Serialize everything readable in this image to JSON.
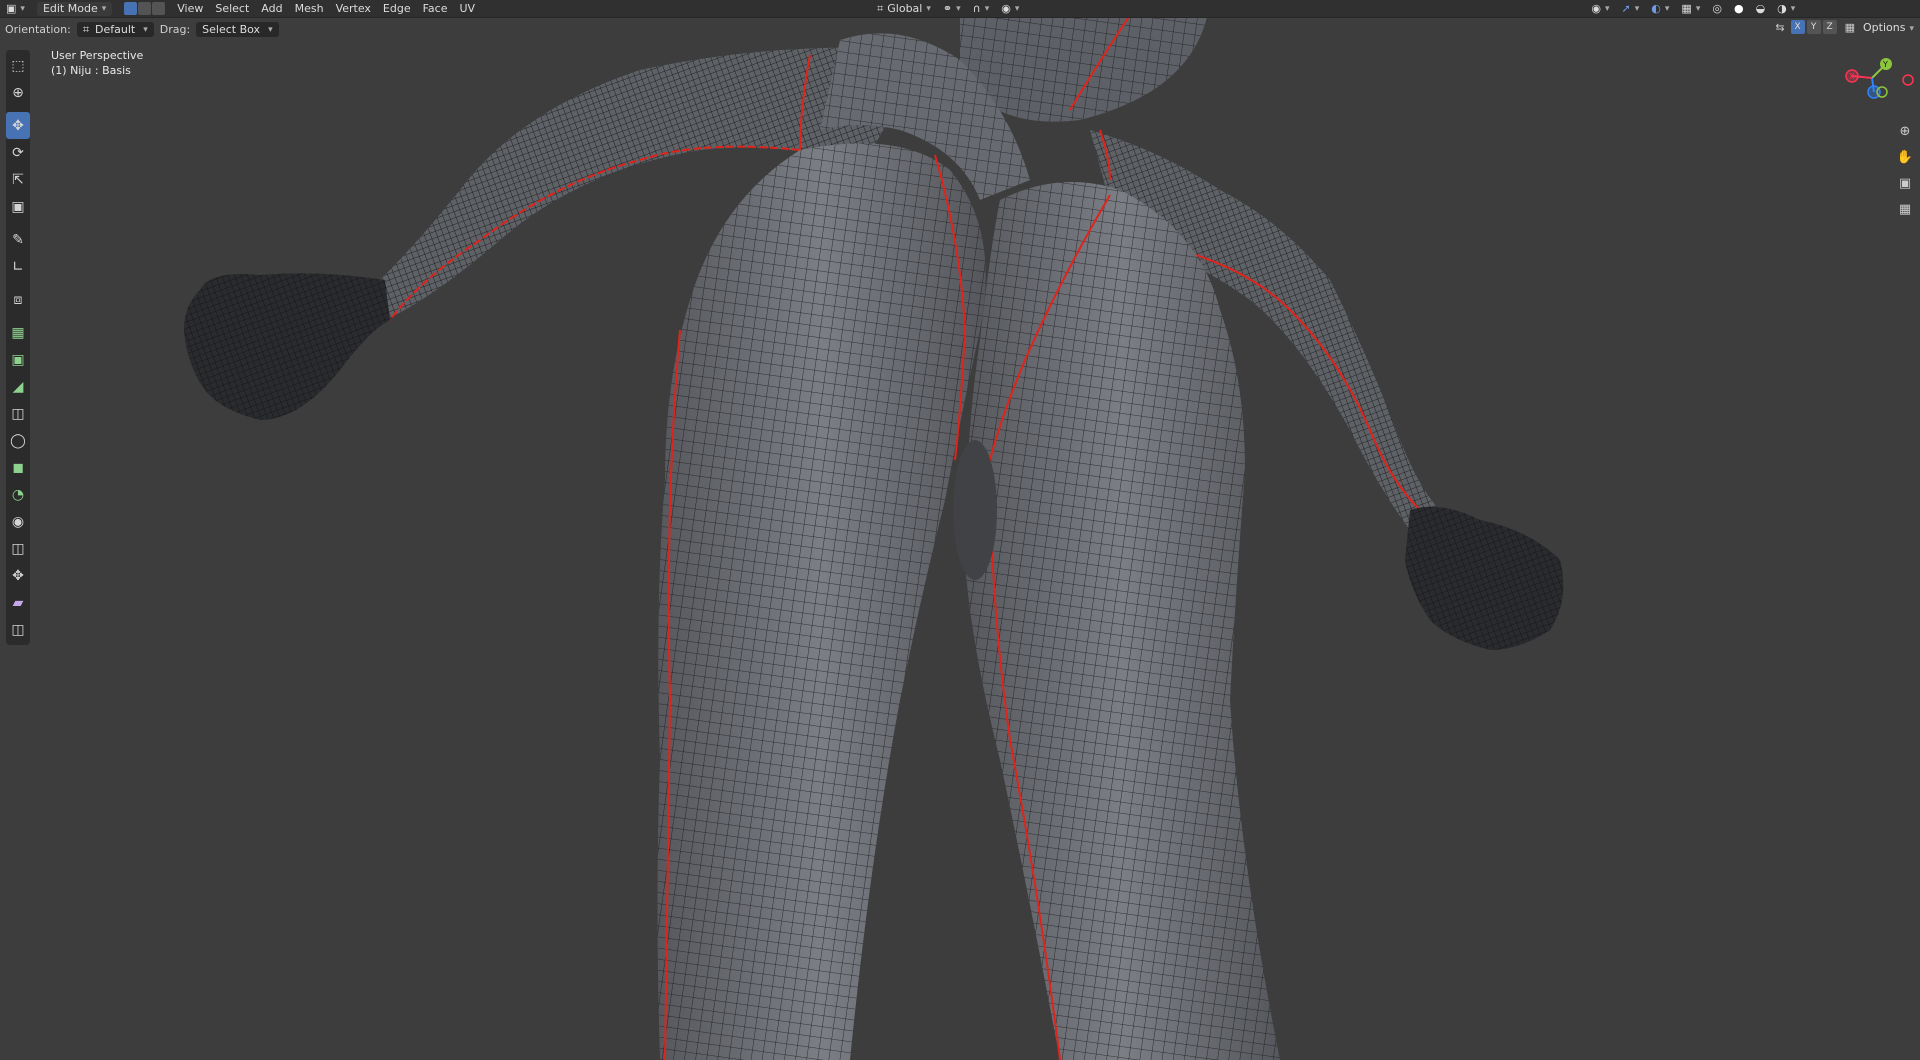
{
  "header": {
    "mode": "Edit Mode",
    "menus": [
      "View",
      "Select",
      "Add",
      "Mesh",
      "Vertex",
      "Edge",
      "Face",
      "UV"
    ],
    "transform_orientation": "Global"
  },
  "tool_header": {
    "orientation_label": "Orientation:",
    "orientation_value": "Default",
    "drag_label": "Drag:",
    "drag_value": "Select Box",
    "options_label": "Options",
    "axes": [
      "X",
      "Y",
      "Z"
    ]
  },
  "viewport": {
    "view_name": "User Perspective",
    "object_info": "(1) Niju : Basis"
  },
  "gizmo_axes": {
    "y": "Y",
    "x": "X"
  },
  "toolbar_icons": [
    "select-box-icon",
    "cursor-icon",
    "move-icon",
    "rotate-icon",
    "scale-icon",
    "transform-icon",
    "annotate-icon",
    "measure-icon",
    "add-cube-icon",
    "extrude-icon",
    "inset-icon",
    "bevel-icon",
    "loop-cut-icon",
    "knife-icon",
    "poly-build-icon",
    "spin-icon",
    "smooth-icon",
    "edge-slide-icon",
    "shrink-fatten-icon",
    "shear-icon",
    "rip-icon"
  ],
  "colors": {
    "viewport_bg": "#3d3d3d",
    "header_bg": "#303030",
    "active_blue": "#4772b3",
    "seam_red": "#e0241b",
    "mesh_fill": "#6b6e75"
  }
}
